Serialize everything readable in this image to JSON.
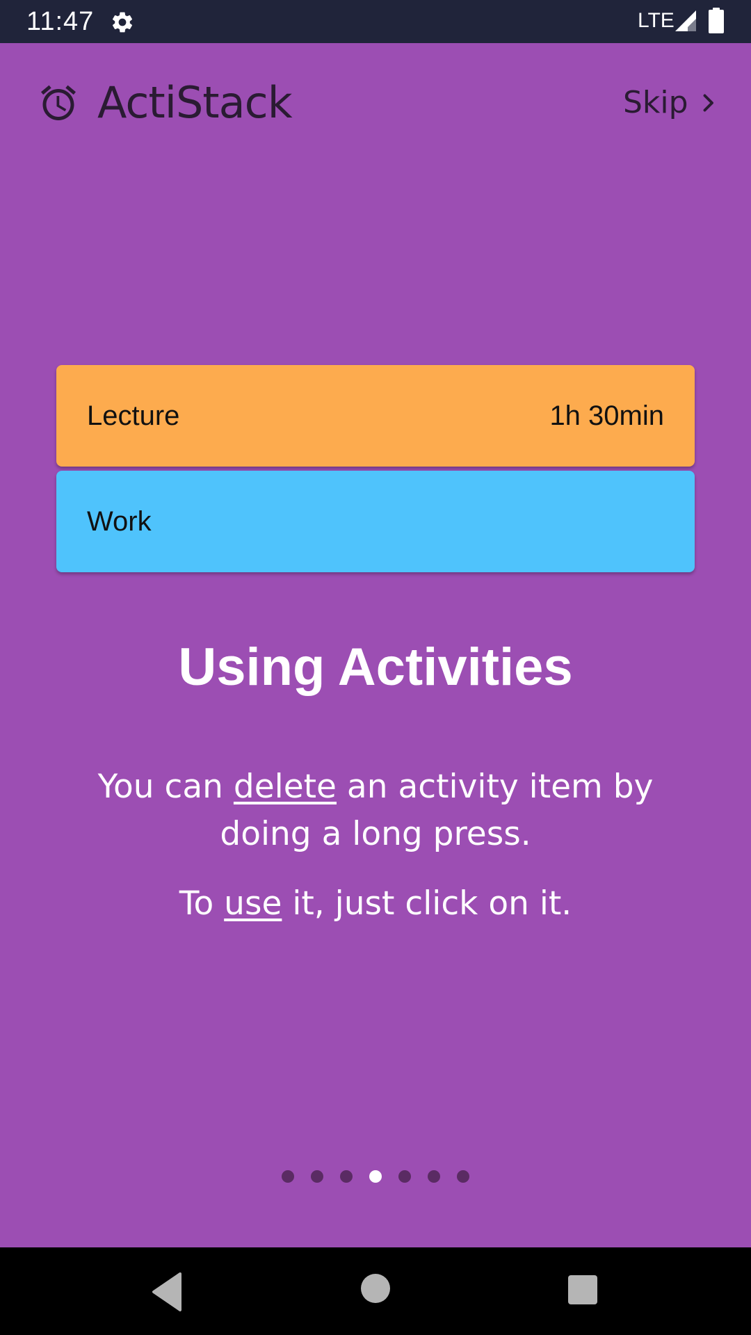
{
  "status_bar": {
    "time": "11:47",
    "settings_icon": "gear-icon",
    "network": "LTE",
    "signal_icon": "signal-icon",
    "battery_icon": "battery-icon"
  },
  "header": {
    "logo_icon": "alarm-clock-icon",
    "app_name": "ActiStack",
    "skip_label": "Skip",
    "skip_icon": "chevron-right-icon"
  },
  "activities": [
    {
      "name": "Lecture",
      "duration": "1h 30min",
      "color": "#fdab4e"
    },
    {
      "name": "Work",
      "duration": "",
      "color": "#4fc3fc"
    }
  ],
  "slide": {
    "title": "Using Activities",
    "line1_prefix": "You can ",
    "line1_keyword": "delete",
    "line1_suffix": " an activity item by doing a long press.",
    "line2_prefix": "To ",
    "line2_keyword": "use",
    "line2_suffix": " it, just click on it."
  },
  "pager": {
    "total_pages": 7,
    "current_page": 4
  },
  "colors": {
    "background": "#9c4eb3",
    "status_bar": "#20243a",
    "header_text": "#2a1b33",
    "dot_inactive": "#5a2b63",
    "dot_active": "#ffffff"
  },
  "nav_bar": {
    "back_icon": "back-triangle-icon",
    "home_icon": "home-circle-icon",
    "recents_icon": "recents-square-icon"
  }
}
